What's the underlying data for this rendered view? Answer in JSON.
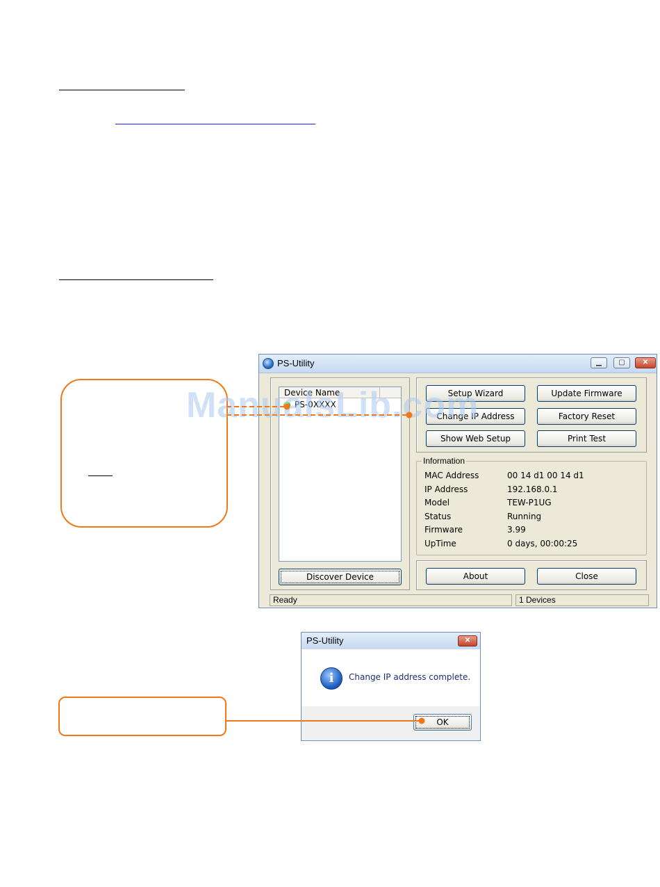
{
  "main_window": {
    "title": "PS-Utility",
    "list_header": "Device Name",
    "device_row": "PS-0XXXX",
    "buttons": {
      "setup_wizard": "Setup Wizard",
      "update_firmware": "Update Firmware",
      "change_ip": "Change IP Address",
      "factory_reset": "Factory Reset",
      "show_web_setup": "Show Web Setup",
      "print_test": "Print Test",
      "discover_device": "Discover Device",
      "about": "About",
      "close": "Close"
    },
    "information": {
      "legend": "Information",
      "rows": [
        {
          "label": "MAC Address",
          "value": "00 14 d1 00 14 d1"
        },
        {
          "label": "IP Address",
          "value": "192.168.0.1"
        },
        {
          "label": "Model",
          "value": "TEW-P1UG"
        },
        {
          "label": "Status",
          "value": "Running"
        },
        {
          "label": "Firmware",
          "value": "3.99"
        },
        {
          "label": "UpTime",
          "value": "0 days, 00:00:25"
        }
      ]
    },
    "status_left": "Ready",
    "status_right": "1 Devices"
  },
  "dialog": {
    "title": "PS-Utility",
    "message": "Change IP address complete.",
    "ok_label": "OK"
  },
  "watermark": "ManualsLib.com",
  "colors": {
    "callout_orange": "#f07818",
    "window_face": "#ece9d8",
    "button_border": "#003c74"
  }
}
